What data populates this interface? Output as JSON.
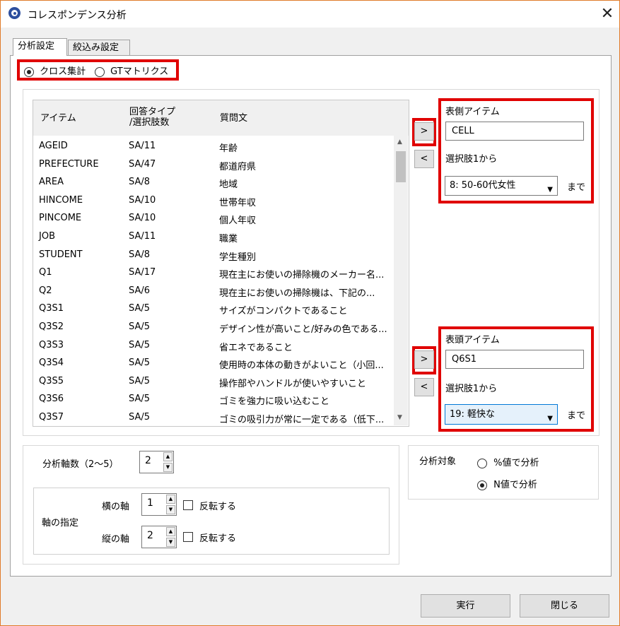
{
  "window": {
    "title": "コレスポンデンス分析",
    "close_glyph": "✕"
  },
  "tabs": [
    {
      "label": "分析設定"
    },
    {
      "label": "絞込み設定"
    }
  ],
  "mode": {
    "cross_label": "クロス集計",
    "gt_label": "GTマトリクス",
    "selected": "cross"
  },
  "list": {
    "headers": {
      "item": "アイテム",
      "type": "回答タイプ\n/選択肢数",
      "question": "質問文"
    },
    "rows": [
      {
        "item": "AGEID",
        "type": "SA/11",
        "question": "年齢"
      },
      {
        "item": "PREFECTURE",
        "type": "SA/47",
        "question": "都道府県"
      },
      {
        "item": "AREA",
        "type": "SA/8",
        "question": "地域"
      },
      {
        "item": "HINCOME",
        "type": "SA/10",
        "question": "世帯年収"
      },
      {
        "item": "PINCOME",
        "type": "SA/10",
        "question": "個人年収"
      },
      {
        "item": "JOB",
        "type": "SA/11",
        "question": "職業"
      },
      {
        "item": "STUDENT",
        "type": "SA/8",
        "question": "学生種別"
      },
      {
        "item": "Q1",
        "type": "SA/17",
        "question": "現在主にお使いの掃除機のメーカー名..."
      },
      {
        "item": "Q2",
        "type": "SA/6",
        "question": "現在主にお使いの掃除機は、下記の..."
      },
      {
        "item": "Q3S1",
        "type": "SA/5",
        "question": "サイズがコンパクトであること"
      },
      {
        "item": "Q3S2",
        "type": "SA/5",
        "question": "デザイン性が高いこと/好みの色である..."
      },
      {
        "item": "Q3S3",
        "type": "SA/5",
        "question": "省エネであること"
      },
      {
        "item": "Q3S4",
        "type": "SA/5",
        "question": "使用時の本体の動きがよいこと（小回..."
      },
      {
        "item": "Q3S5",
        "type": "SA/5",
        "question": "操作部やハンドルが使いやすいこと"
      },
      {
        "item": "Q3S6",
        "type": "SA/5",
        "question": "ゴミを強力に吸い込むこと"
      },
      {
        "item": "Q3S7",
        "type": "SA/5",
        "question": "ゴミの吸引力が常に一定である（低下..."
      }
    ]
  },
  "move": {
    "add": ">",
    "remove": "<"
  },
  "side": {
    "title": "表側アイテム",
    "value": "CELL",
    "from_label": "選択肢1から",
    "to_value": "8: 50-60代女性",
    "until": "まで"
  },
  "head": {
    "title": "表頭アイテム",
    "value": "Q6S1",
    "from_label": "選択肢1から",
    "to_value": "19: 軽快な",
    "until": "まで"
  },
  "axes": {
    "count_label": "分析軸数（2〜5）",
    "count_value": "2",
    "spec_label": "軸の指定",
    "h_label": "横の軸",
    "h_value": "1",
    "h_flip": "反転する",
    "v_label": "縦の軸",
    "v_value": "2",
    "v_flip": "反転する"
  },
  "target": {
    "label": "分析対象",
    "pct_label": "%値で分析",
    "n_label": "N値で分析",
    "selected": "n"
  },
  "footer": {
    "run": "実行",
    "close": "閉じる"
  }
}
